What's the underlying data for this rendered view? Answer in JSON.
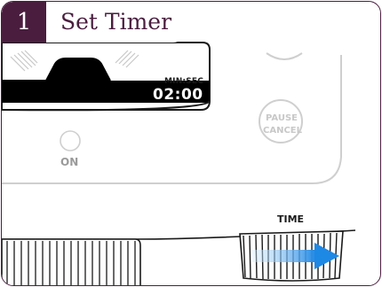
{
  "step": {
    "number": "1",
    "title": "Set Timer"
  },
  "display": {
    "unit_label": "MIN:SEC",
    "time": "02:00"
  },
  "controls": {
    "on_label": "ON",
    "pause_label": "PAUSE",
    "cancel_label": "CANCEL",
    "dial_label": "TIME"
  },
  "colors": {
    "brand": "#4a1d3f",
    "arrow_start": "#d7ecfb",
    "arrow_end": "#1e88e5"
  },
  "icons": [
    "direction-arrow-icon"
  ]
}
